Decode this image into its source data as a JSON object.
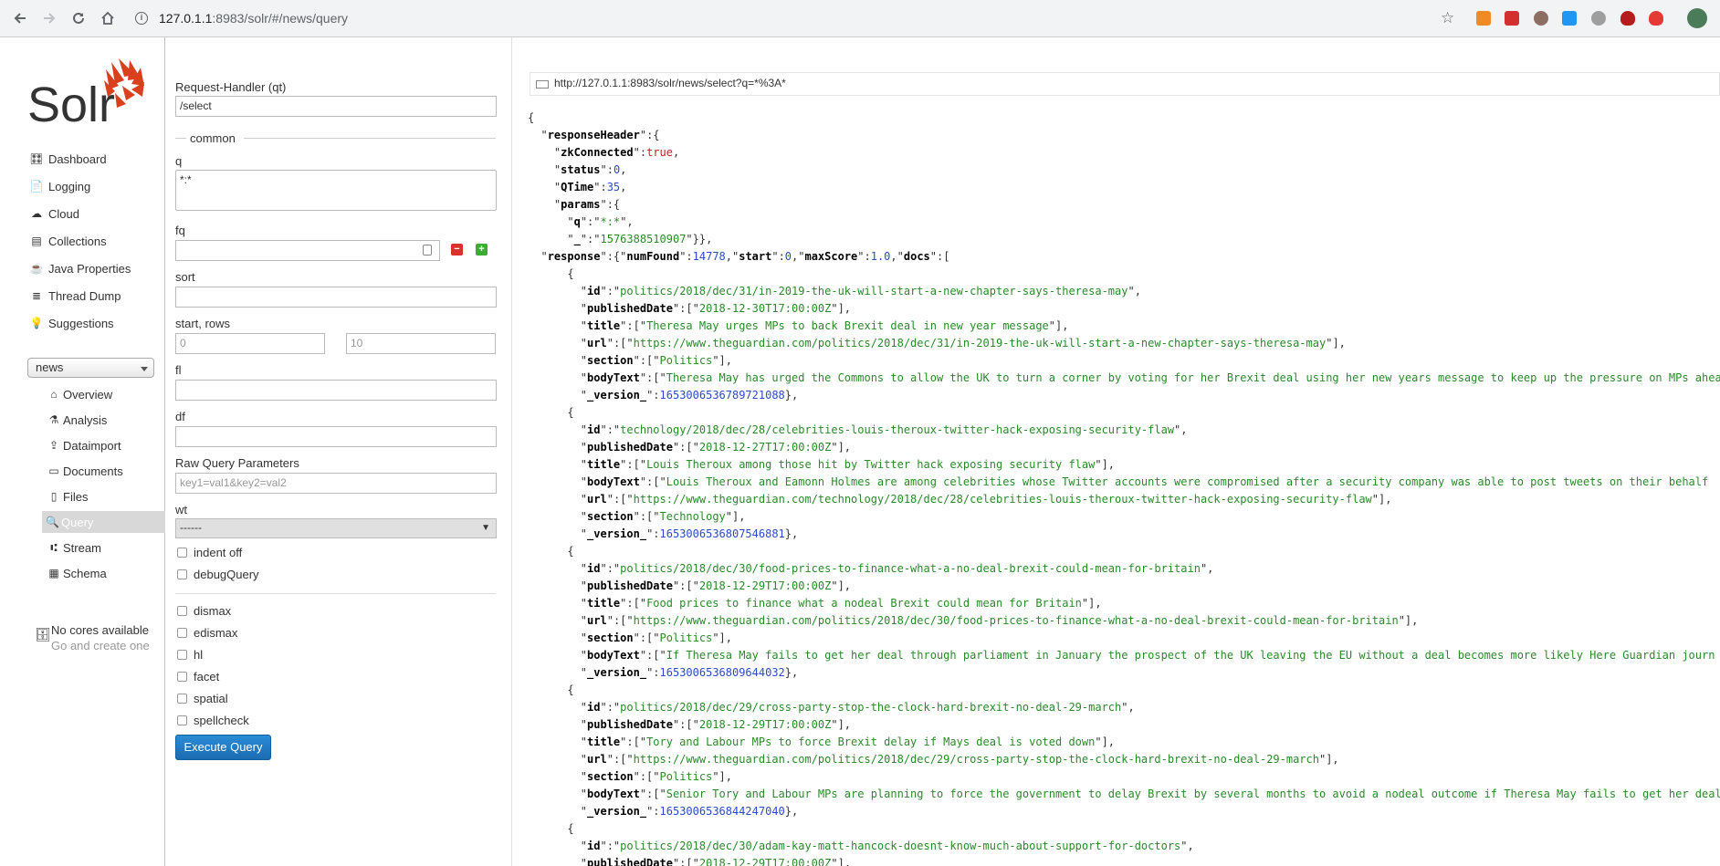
{
  "browser": {
    "url_host": "127.0.1.1",
    "url_rest": ":8983/solr/#/news/query"
  },
  "sidebar": {
    "logo_text": "Solr",
    "menu": [
      {
        "label": "Dashboard",
        "icon": "dashboard-icon"
      },
      {
        "label": "Logging",
        "icon": "logging-icon"
      },
      {
        "label": "Cloud",
        "icon": "cloud-icon"
      },
      {
        "label": "Collections",
        "icon": "collections-icon"
      },
      {
        "label": "Java Properties",
        "icon": "java-icon"
      },
      {
        "label": "Thread Dump",
        "icon": "thread-dump-icon"
      },
      {
        "label": "Suggestions",
        "icon": "suggestions-icon"
      }
    ],
    "core_selector": "news",
    "core_menu": [
      {
        "label": "Overview",
        "icon": "home-icon"
      },
      {
        "label": "Analysis",
        "icon": "analysis-icon"
      },
      {
        "label": "Dataimport",
        "icon": "dataimport-icon"
      },
      {
        "label": "Documents",
        "icon": "documents-icon"
      },
      {
        "label": "Files",
        "icon": "files-icon"
      },
      {
        "label": "Query",
        "icon": "query-icon",
        "active": true
      },
      {
        "label": "Stream",
        "icon": "stream-icon"
      },
      {
        "label": "Schema",
        "icon": "schema-icon"
      }
    ],
    "no_cores_line1": "No cores available",
    "no_cores_line2": "Go and create one"
  },
  "form": {
    "request_handler_label": "Request-Handler (qt)",
    "request_handler_value": "/select",
    "common_label": "common",
    "q_label": "q",
    "q_value": "*:*",
    "fq_label": "fq",
    "fq_value": "",
    "sort_label": "sort",
    "start_rows_label": "start, rows",
    "start_placeholder": "0",
    "rows_placeholder": "10",
    "fl_label": "fl",
    "df_label": "df",
    "raw_label": "Raw Query Parameters",
    "raw_placeholder": "key1=val1&key2=val2",
    "wt_label": "wt",
    "wt_value": "------",
    "indent_label": "indent off",
    "debug_label": "debugQuery",
    "dismax_label": "dismax",
    "edismax_label": "edismax",
    "hl_label": "hl",
    "facet_label": "facet",
    "spatial_label": "spatial",
    "spellcheck_label": "spellcheck",
    "execute_label": "Execute Query"
  },
  "response": {
    "request_url": "http://127.0.1.1:8983/solr/news/select?q=*%3A*"
  }
}
